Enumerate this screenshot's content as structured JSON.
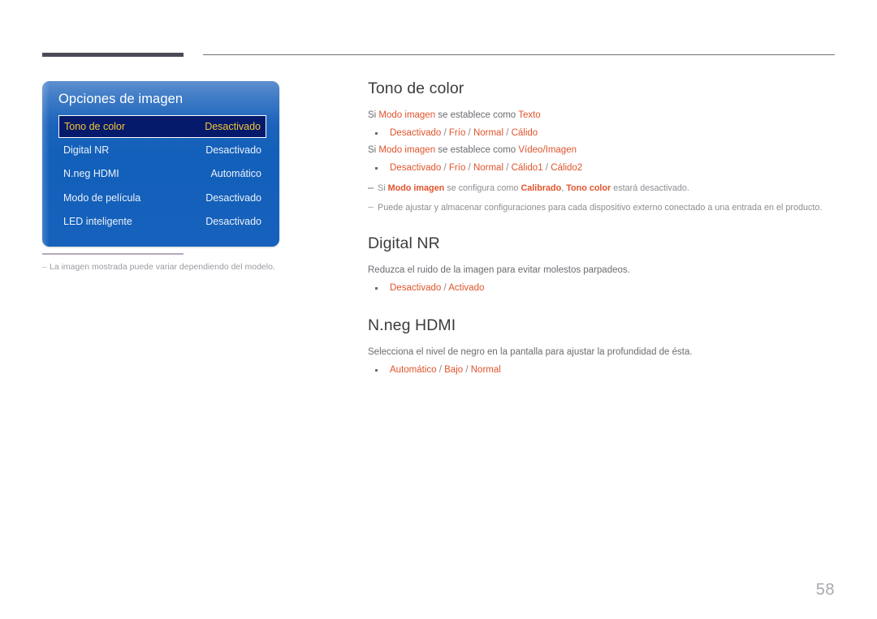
{
  "page": {
    "number": "58",
    "background": "#ffffff"
  },
  "colors": {
    "header_rule_thick": "#4b4b58",
    "header_rule_thin": "#6f6f78",
    "highlight_orange": "#e0542c",
    "osd_blue": "#1260ba",
    "osd_selected_bg": "#061a6b",
    "osd_selected_text": "#f0c637",
    "body_text": "#6c6c72",
    "heading_text": "#3c3c3c",
    "note_text": "#8d8d93",
    "page_number": "#a8a8b0",
    "separator_mauve": "#b8a9bd"
  },
  "osd": {
    "title": "Opciones de imagen",
    "rows": [
      {
        "label": "Tono de color",
        "value": "Desactivado",
        "selected": true
      },
      {
        "label": "Digital NR",
        "value": "Desactivado",
        "selected": false
      },
      {
        "label": "N.neg HDMI",
        "value": "Automático",
        "selected": false
      },
      {
        "label": "Modo de película",
        "value": "Desactivado",
        "selected": false
      },
      {
        "label": "LED inteligente",
        "value": "Desactivado",
        "selected": false
      }
    ],
    "footnote_dash": "–",
    "footnote": "La imagen mostrada puede variar dependiendo del modelo."
  },
  "sections": [
    {
      "title": "Tono de color",
      "line1_pre": "Si ",
      "line1_term": "Modo imagen",
      "line1_mid": " se establece como ",
      "line1_value": "Texto",
      "bullet1": {
        "options": [
          "Desactivado",
          "Frío",
          "Normal",
          "Cálido"
        ],
        "separator": " / "
      },
      "line2_pre": "Si ",
      "line2_term": "Modo imagen",
      "line2_mid": " se establece como ",
      "line2_value": "Vídeo/Imagen",
      "bullet2": {
        "options": [
          "Desactivado",
          "Frío",
          "Normal",
          "Cálido1",
          "Cálido2"
        ],
        "separator": " / "
      },
      "note1": {
        "pre": "Si ",
        "term1": "Modo imagen",
        "mid1": " se configura como ",
        "term2": "Calibrado",
        "mid2": ", ",
        "term3": "Tono color",
        "post": " estará desactivado."
      },
      "note2": "Puede ajustar y almacenar configuraciones para cada dispositivo externo conectado a una entrada en el producto."
    },
    {
      "title": "Digital NR",
      "description": "Reduzca el ruido de la imagen para evitar molestos parpadeos.",
      "bullet": {
        "options": [
          "Desactivado",
          "Activado"
        ],
        "separator": " / "
      }
    },
    {
      "title": "N.neg HDMI",
      "description": "Selecciona el nivel de negro en la pantalla para ajustar la profundidad de ésta.",
      "bullet": {
        "options": [
          "Automático",
          "Bajo",
          "Normal"
        ],
        "separator": " / "
      }
    }
  ]
}
